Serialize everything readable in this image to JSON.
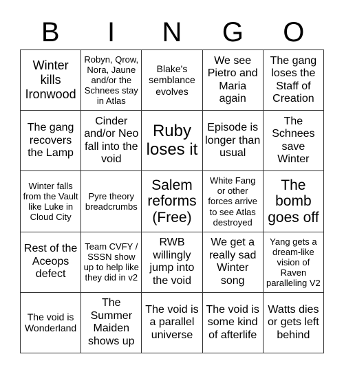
{
  "header": [
    "B",
    "I",
    "N",
    "G",
    "O"
  ],
  "cells": [
    "Winter kills Ironwood",
    "Robyn, Qrow, Nora, Jaune and/or the Schnees stay in Atlas",
    "Blake's semblance evolves",
    "We see Pietro and Maria again",
    "The gang loses the Staff of Creation",
    "The gang recovers the Lamp",
    "Cinder and/or Neo fall into the void",
    "Ruby loses it",
    "Episode is longer than usual",
    "The Schnees save Winter",
    "Winter falls from the Vault like Luke in Cloud City",
    "Pyre theory breadcrumbs",
    "Salem reforms (Free)",
    "White Fang or other forces arrive to see Atlas destroyed",
    "The bomb goes off",
    "Rest of the Aceops defect",
    "Team CVFY / SSSN show up to help like they did in v2",
    "RWB willingly jump into the void",
    "We get a really sad Winter song",
    "Yang gets a dream-like vision of Raven paralleling V2",
    "The void is Wonderland",
    "The Summer Maiden shows up",
    "The void is a parallel universe",
    "The void is some kind of afterlife",
    "Watts dies or gets left behind"
  ]
}
